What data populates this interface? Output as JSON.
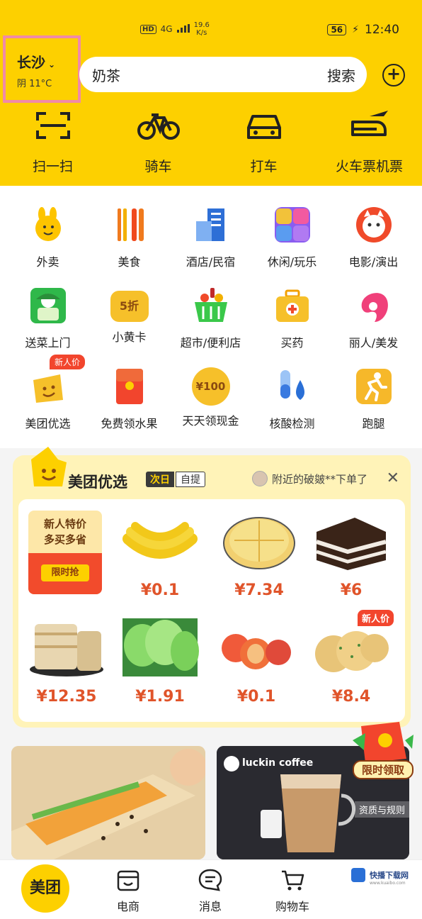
{
  "status_bar": {
    "hd": "HD",
    "network": "4G",
    "speed_value": "19.6",
    "speed_unit": "K/s",
    "battery": "56",
    "time": "12:40"
  },
  "header": {
    "city": "长沙",
    "weather": "阴 11°C",
    "search_value": "奶茶",
    "search_button": "搜索",
    "quick_actions": [
      {
        "label": "扫一扫",
        "icon": "scan-icon"
      },
      {
        "label": "骑车",
        "icon": "bicycle-icon"
      },
      {
        "label": "打车",
        "icon": "car-icon"
      },
      {
        "label": "火车票机票",
        "icon": "train-plane-icon"
      }
    ]
  },
  "categories": [
    {
      "label": "外卖",
      "icon": "kangaroo-icon"
    },
    {
      "label": "美食",
      "icon": "fork-icon"
    },
    {
      "label": "酒店/民宿",
      "icon": "building-icon"
    },
    {
      "label": "休闲/玩乐",
      "icon": "leisure-icon"
    },
    {
      "label": "电影/演出",
      "icon": "cat-icon"
    },
    {
      "label": "送菜上门",
      "icon": "vegetable-icon"
    },
    {
      "label": "小黄卡",
      "icon": "yellow-card-icon",
      "badge": "5折"
    },
    {
      "label": "超市/便利店",
      "icon": "basket-icon"
    },
    {
      "label": "买药",
      "icon": "medicine-box-icon"
    },
    {
      "label": "丽人/美发",
      "icon": "hair-icon"
    },
    {
      "label": "美团优选",
      "icon": "smile-bag-icon",
      "tag": "新人价"
    },
    {
      "label": "免费领水果",
      "icon": "red-packet-icon"
    },
    {
      "label": "天天领现金",
      "icon": "coin-icon",
      "badge": "¥100"
    },
    {
      "label": "核酸检测",
      "icon": "test-tube-icon"
    },
    {
      "label": "跑腿",
      "icon": "runner-icon"
    }
  ],
  "youxuan": {
    "title": "美团优选",
    "next_day": "次日",
    "pickup": "自提",
    "notice": "附近的破皴**下单了",
    "promo": {
      "line1": "新人特价",
      "line2": "多买多省",
      "button": "限时抢"
    },
    "products": [
      {
        "price": "¥0.1",
        "icon": "banana-icon"
      },
      {
        "price": "¥7.34",
        "icon": "pancake-icon"
      },
      {
        "price": "¥6",
        "icon": "cake-icon"
      },
      {
        "price": "¥12.35",
        "icon": "flatbread-icon"
      },
      {
        "price": "¥1.91",
        "icon": "lettuce-icon"
      },
      {
        "price": "¥0.1",
        "icon": "peach-icon"
      },
      {
        "price": "¥8.4",
        "icon": "scallion-cake-icon",
        "tag": "新人价"
      }
    ]
  },
  "banners": {
    "coffee_brand": "luckin coffee",
    "rules": "资质与规则",
    "red_envelope": "限时领取"
  },
  "tabbar": [
    {
      "label": "美团"
    },
    {
      "label": "电商",
      "icon": "shop-bag-icon"
    },
    {
      "label": "消息",
      "icon": "message-icon"
    },
    {
      "label": "购物车",
      "icon": "cart-icon"
    }
  ],
  "watermark": {
    "title": "快播下载网",
    "sub": "www.kuaibo.com"
  },
  "colors": {
    "brand_yellow": "#fdd000",
    "price_orange": "#e0542a",
    "tag_red": "#f2452d"
  }
}
